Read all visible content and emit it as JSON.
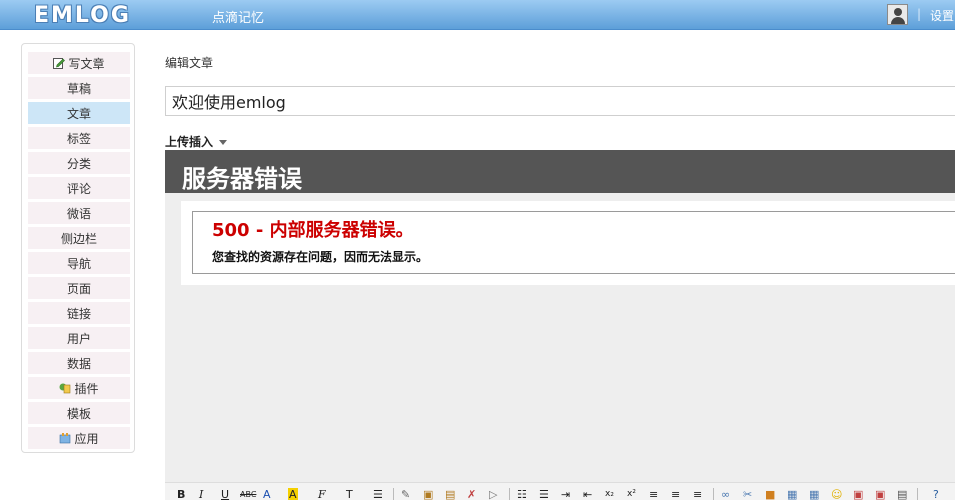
{
  "header": {
    "logo_text": "EMLOG",
    "site_name": "点滴记忆",
    "separator": "|",
    "settings_label": "设置"
  },
  "sidebar": {
    "items": [
      {
        "label": "写文章",
        "icon": "pencil-icon"
      },
      {
        "label": "草稿"
      },
      {
        "label": "文章",
        "active": true
      },
      {
        "label": "标签"
      },
      {
        "label": "分类"
      },
      {
        "label": "评论"
      },
      {
        "label": "微语"
      },
      {
        "label": "侧边栏"
      },
      {
        "label": "导航"
      },
      {
        "label": "页面"
      },
      {
        "label": "链接"
      },
      {
        "label": "用户"
      },
      {
        "label": "数据"
      },
      {
        "label": "插件",
        "icon": "plugin-icon"
      },
      {
        "label": "模板"
      },
      {
        "label": "应用",
        "icon": "app-icon"
      }
    ]
  },
  "main": {
    "page_title": "编辑文章",
    "title_value": "欢迎使用emlog",
    "upload_insert_label": "上传插入"
  },
  "error": {
    "header": "服务器错误",
    "code_line": "500 - 内部服务器错误。",
    "message": "您查找的资源存在问题，因而无法显示。"
  },
  "toolbar": {
    "bold": "B",
    "italic": "I",
    "underline": "U",
    "strike": "ABC",
    "font_color": "A",
    "bg_color": "A",
    "font_family": "F",
    "font_size": "T"
  },
  "colors": {
    "header_gradient_top": "#9ccbf2",
    "header_gradient_bottom": "#5d9fd9",
    "active_item": "#cde6f7",
    "error_header_bg": "#555555",
    "error_text": "#cc0000"
  }
}
